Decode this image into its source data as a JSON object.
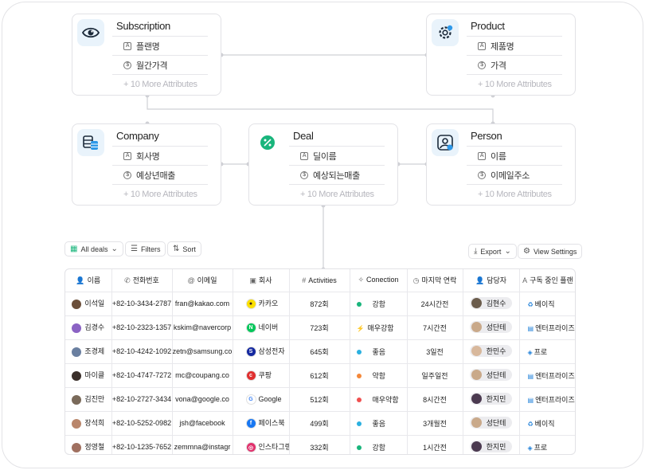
{
  "colors": {
    "accent": "#2e98e8",
    "green": "#19b57c",
    "red": "#f05050",
    "orange": "#f4883a",
    "cyan": "#2bb0e0"
  },
  "entities": {
    "subscription": {
      "title": "Subscription",
      "icon": "eye-icon",
      "attrs": [
        "플랜명",
        "월간가격"
      ],
      "more": "+ 10 More Attributes"
    },
    "product": {
      "title": "Product",
      "icon": "gear-icon",
      "attrs": [
        "제품명",
        "가격"
      ],
      "more": "+ 10 More Attributes"
    },
    "company": {
      "title": "Company",
      "icon": "coins-icon",
      "attrs": [
        "회사명",
        "예상년매출"
      ],
      "more": "+ 10 More Attributes"
    },
    "deal": {
      "title": "Deal",
      "icon": "percent-icon",
      "attrs": [
        "딜이름",
        "예상되는매출"
      ],
      "more": "+ 10 More Attributes"
    },
    "person": {
      "title": "Person",
      "icon": "person-icon",
      "attrs": [
        "이름",
        "이메일주소"
      ],
      "more": "+ 10 More Attributes"
    }
  },
  "toolbar": {
    "view": "All deals",
    "filters": "Filters",
    "sort": "Sort",
    "export": "Export",
    "view_settings": "View Settings"
  },
  "table": {
    "columns": [
      "이름",
      "전화번호",
      "이메일",
      "회사",
      "Activities",
      "Conection",
      "마지막 연락",
      "담당자",
      "구독 중인 플랜"
    ],
    "rows": [
      {
        "name": "이석일",
        "phone": "+82-10-3434-2787",
        "email": "fran@kakao.com",
        "company": "카카오",
        "activities": "872회",
        "connection": "강함",
        "last": "24시간전",
        "owner": "김현수",
        "plan": "베이직"
      },
      {
        "name": "김경수",
        "phone": "+82-10-2323-1357",
        "email": "kskim@navercorp",
        "company": "네이버",
        "activities": "723회",
        "connection": "매우강함",
        "last": "7시간전",
        "owner": "성단테",
        "plan": "엔터프라이즈"
      },
      {
        "name": "조경제",
        "phone": "+82-10-4242-1092",
        "email": "zetn@samsung.co",
        "company": "삼성전자",
        "activities": "645회",
        "connection": "좋음",
        "last": "3일전",
        "owner": "한민수",
        "plan": "프로"
      },
      {
        "name": "마이클",
        "phone": "+82-10-4747-7272",
        "email": "mc@coupang.co",
        "company": "쿠팡",
        "activities": "612회",
        "connection": "약함",
        "last": "일주일전",
        "owner": "성단테",
        "plan": "엔터프라이즈"
      },
      {
        "name": "김진만",
        "phone": "+82-10-2727-3434",
        "email": "vona@google.co",
        "company": "Google",
        "activities": "512회",
        "connection": "매우약함",
        "last": "8시간전",
        "owner": "한지민",
        "plan": "엔터프라이즈"
      },
      {
        "name": "장석희",
        "phone": "+82-10-5252-0982",
        "email": "jsh@facebook",
        "company": "페이스북",
        "activities": "499회",
        "connection": "좋음",
        "last": "3개월전",
        "owner": "성단테",
        "plan": "베이직"
      },
      {
        "name": "정영철",
        "phone": "+82-10-1235-7652",
        "email": "zemmna@instagr",
        "company": "인스타그램",
        "activities": "332회",
        "connection": "강함",
        "last": "1시간전",
        "owner": "한지민",
        "plan": "프로"
      }
    ]
  }
}
